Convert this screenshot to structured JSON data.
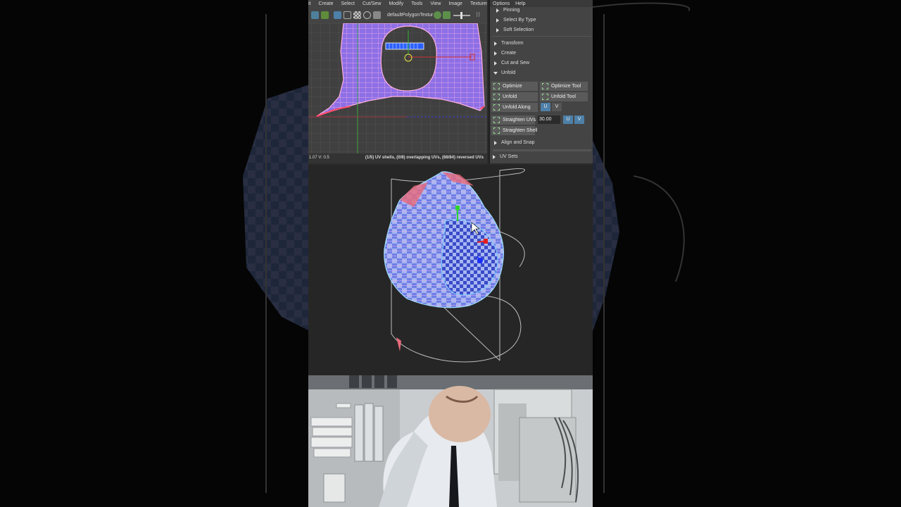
{
  "colors": {
    "background": "#000000",
    "ui_panel": "#444444",
    "uv_wire": "#ff9fdc",
    "uv_fill": "#8d6fe6",
    "accent_blue": "#4e80a8",
    "selection_blue": "#2a5fff"
  },
  "uv_editor": {
    "menus": [
      "it",
      "Create",
      "Select",
      "Cut/Sew",
      "Modify",
      "Tools",
      "View",
      "Image",
      "Textures"
    ],
    "toolbar": {
      "texture_label": "defaultPolygonTextur",
      "icons": [
        "uv-grid-icon",
        "uv-lattice-icon",
        "uv-select-icon",
        "uv-frame-icon",
        "checker-icon",
        "display-icon",
        "camera-icon",
        "exposure-icon",
        "gamma-icon"
      ]
    },
    "status_left": "1.07 V:  0.5",
    "status_right": "(1/5) UV shells, (0/8) overlapping UVs, (68/84) reversed UVs"
  },
  "tool_panel": {
    "menus": [
      "Options",
      "Help"
    ],
    "sections": {
      "pinning": "Pinning",
      "select_by_type": "Select By Type",
      "soft_selection": "Soft Selection",
      "transform": "Transform",
      "create": "Create",
      "cut_and_sew": "Cut and Sew",
      "unfold": "Unfold",
      "align_and_snap": "Align and Snap",
      "uv_sets": "UV Sets"
    },
    "unfold_tools": {
      "optimize": "Optimize",
      "optimize_tool": "Optimize Tool",
      "unfold": "Unfold",
      "unfold_tool": "Unfold Tool",
      "unfold_along": "Unfold Along",
      "straighten_uvs": "Straighten UVs",
      "straighten_value": "30.00",
      "straighten_shell": "Straighten Shell",
      "u": "U",
      "v": "V"
    }
  }
}
